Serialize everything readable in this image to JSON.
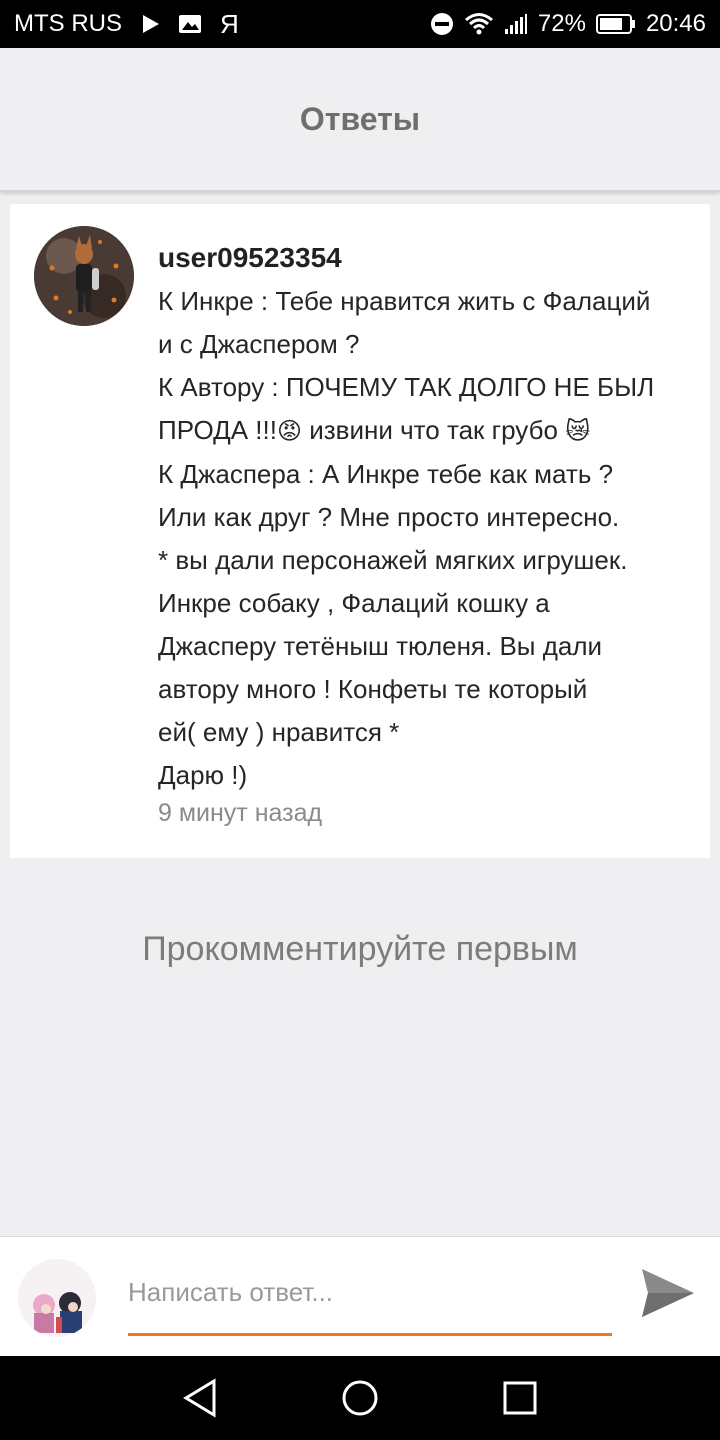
{
  "status_bar": {
    "carrier": "MTS RUS",
    "battery": "72%",
    "time": "20:46",
    "icons": [
      "play-icon",
      "image-icon",
      "yandex-icon",
      "dnd-icon",
      "wifi-icon",
      "signal-icon",
      "battery-icon"
    ]
  },
  "header": {
    "title": "Ответы"
  },
  "comment": {
    "username": "user09523354",
    "lines": [
      "К Инкре : Тебе нравится жить с Фалаций",
      "и с Джаспером ?",
      "К Автору : ПОЧЕМУ ТАК ДОЛГО НЕ БЫЛ",
      "ПРОДА !!!",
      " извини что так грубо ",
      "К Джаспера : А Инкре тебе как мать ?",
      "Или как друг ? Мне просто интересно.",
      "* вы дали персонажей мягких игрушек.",
      "Инкре собаку , Фалаций кошку а",
      "Джасперу тетёныш тюленя. Вы дали",
      "автору много ! Конфеты те который",
      "ей( ему ) нравится *",
      "Дарю !)"
    ],
    "emoji_angry": "😡",
    "emoji_cat": "😿",
    "timestamp": "9 минут назад"
  },
  "empty_prompt": "Прокомментируйте первым",
  "reply": {
    "placeholder": "Написать ответ...",
    "value": ""
  },
  "colors": {
    "accent": "#ff6f21",
    "background": "#efeef0",
    "card": "#ffffff"
  }
}
